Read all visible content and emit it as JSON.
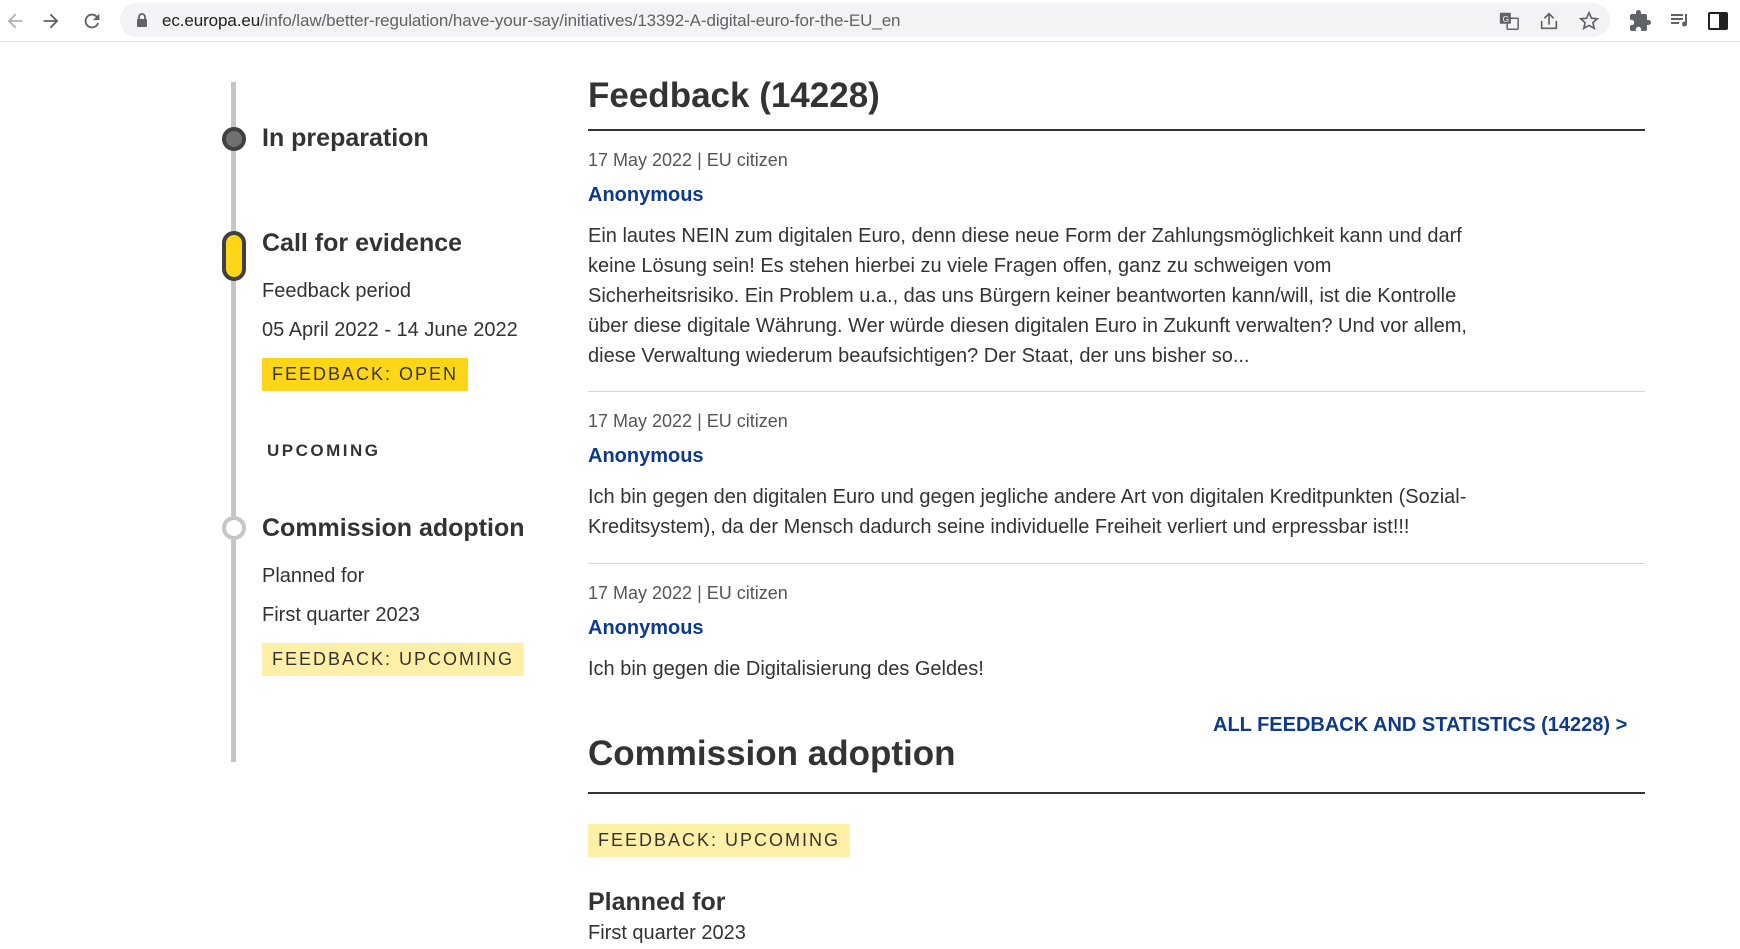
{
  "browser": {
    "url_domain": "ec.europa.eu",
    "url_path": "/info/law/better-regulation/have-your-say/initiatives/13392-A-digital-euro-for-the-EU_en",
    "icons": [
      "back-icon",
      "forward-icon",
      "reload-icon",
      "lock-icon",
      "translate-icon",
      "share-icon",
      "star-icon",
      "extensions-icon",
      "reading-list-icon",
      "side-panel-icon"
    ]
  },
  "timeline": {
    "stage1": {
      "title": "In preparation"
    },
    "stage2": {
      "title": "Call for evidence",
      "label": "Feedback period",
      "dates": "05 April 2022 - 14 June 2022",
      "badge": "FEEDBACK: OPEN"
    },
    "upcoming_label": "UPCOMING",
    "stage3": {
      "title": "Commission adoption",
      "label": "Planned for",
      "value": "First quarter 2023",
      "badge": "FEEDBACK: UPCOMING"
    }
  },
  "feedback": {
    "title": "Feedback (14228)",
    "items": [
      {
        "meta": "17 May 2022 | EU citizen",
        "author": "Anonymous",
        "text": "Ein lautes NEIN zum digitalen Euro, denn diese neue Form der Zahlungsmöglichkeit kann und darf keine Lösung sein! Es stehen hierbei zu viele Fragen offen, ganz zu schweigen vom Sicherheitsrisiko. Ein Problem u.a., das uns Bürgern keiner beantworten kann/will, ist die Kontrolle über diese digitale Währung. Wer würde diesen digitalen Euro in Zukunft verwalten? Und vor allem, diese Verwaltung wiederum beaufsichtigen? Der Staat, der uns bisher so..."
      },
      {
        "meta": "17 May 2022 | EU citizen",
        "author": "Anonymous",
        "text": "Ich bin gegen den digitalen Euro und gegen jegliche andere Art von digitalen Kreditpunkten (Sozial-Kreditsystem), da der Mensch dadurch seine individuelle Freiheit verliert und erpressbar ist!!!"
      },
      {
        "meta": "17 May 2022 | EU citizen",
        "author": "Anonymous",
        "text": "Ich bin gegen die Digitalisierung des Geldes!"
      }
    ],
    "all_link": "ALL FEEDBACK AND STATISTICS (14228) >"
  },
  "adoption": {
    "title": "Commission adoption",
    "badge": "FEEDBACK: UPCOMING",
    "planned_label": "Planned for",
    "planned_value": "First quarter 2023"
  },
  "colors": {
    "accent_yellow": "#ffd617",
    "upcoming_yellow": "#fff0a8",
    "link_blue": "#0e3a8c",
    "text": "#333333"
  }
}
